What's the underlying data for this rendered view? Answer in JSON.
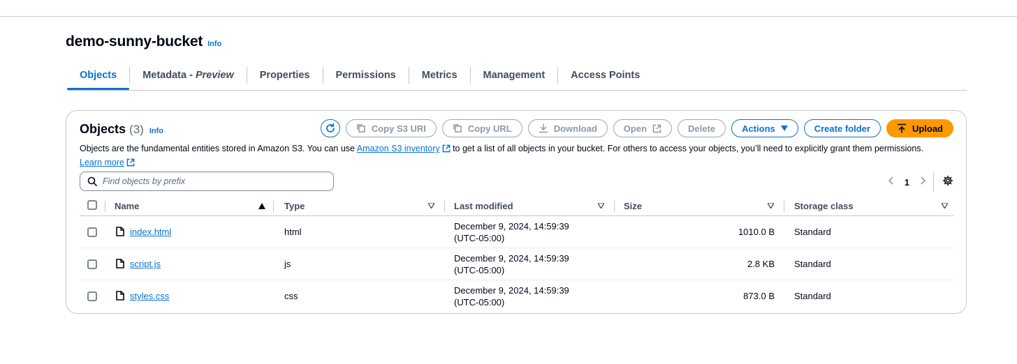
{
  "bucket": {
    "name": "demo-sunny-bucket",
    "info_label": "Info"
  },
  "tabs": [
    {
      "label": "Objects",
      "active": true
    },
    {
      "label": "Metadata - ",
      "suffix": "Preview"
    },
    {
      "label": "Properties"
    },
    {
      "label": "Permissions"
    },
    {
      "label": "Metrics"
    },
    {
      "label": "Management"
    },
    {
      "label": "Access Points"
    }
  ],
  "objects_panel": {
    "title": "Objects",
    "count": "(3)",
    "info_label": "Info",
    "buttons": {
      "copy_s3_uri": "Copy S3 URI",
      "copy_url": "Copy URL",
      "download": "Download",
      "open": "Open",
      "delete": "Delete",
      "actions": "Actions",
      "create_folder": "Create folder",
      "upload": "Upload"
    },
    "description_pre": "Objects are the fundamental entities stored in Amazon S3. You can use ",
    "inventory_link": "Amazon S3 inventory",
    "description_post": " to get a list of all objects in your bucket. For others to access your objects, you’ll need to explicitly grant them permissions.",
    "learn_more": "Learn more",
    "search_placeholder": "Find objects by prefix",
    "page_number": "1"
  },
  "table": {
    "columns": {
      "name": "Name",
      "type": "Type",
      "last_modified": "Last modified",
      "size": "Size",
      "storage_class": "Storage class"
    },
    "rows": [
      {
        "name": "index.html",
        "type": "html",
        "date_line1": "December 9, 2024, 14:59:39",
        "date_line2": "(UTC-05:00)",
        "size": "1010.0 B",
        "storage_class": "Standard"
      },
      {
        "name": "script.js",
        "type": "js",
        "date_line1": "December 9, 2024, 14:59:39",
        "date_line2": "(UTC-05:00)",
        "size": "2.8 KB",
        "storage_class": "Standard"
      },
      {
        "name": "styles.css",
        "type": "css",
        "date_line1": "December 9, 2024, 14:59:39",
        "date_line2": "(UTC-05:00)",
        "size": "873.0 B",
        "storage_class": "Standard"
      }
    ]
  },
  "colors": {
    "accent": "#0972d3",
    "upload": "#ff9900",
    "border": "#c6c6cd"
  }
}
